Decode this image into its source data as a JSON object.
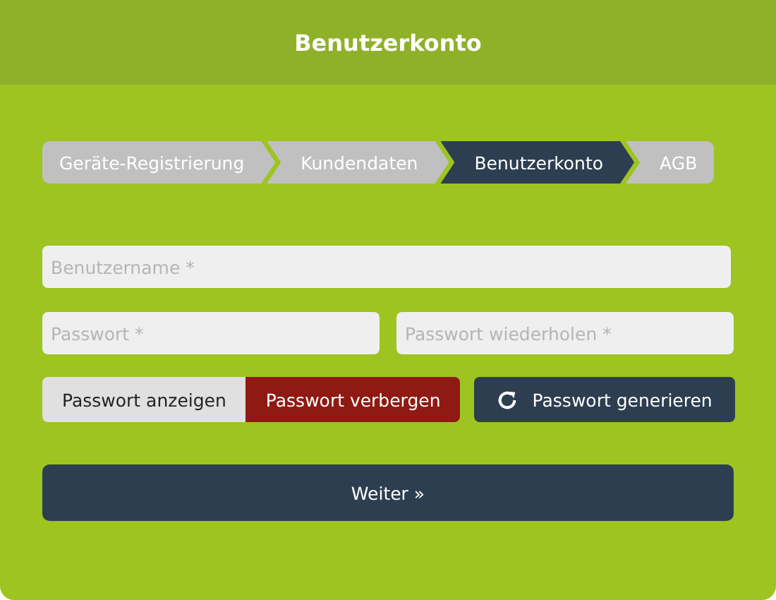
{
  "header": {
    "title": "Benutzerkonto"
  },
  "steps": [
    {
      "label": "Geräte-Registrierung",
      "selected": false
    },
    {
      "label": "Kundendaten",
      "selected": false
    },
    {
      "label": "Benutzerkonto",
      "selected": true
    },
    {
      "label": "AGB",
      "selected": false
    }
  ],
  "fields": {
    "username": {
      "placeholder": "Benutzername *"
    },
    "password": {
      "placeholder": "Passwort *"
    },
    "password_repeat": {
      "placeholder": "Passwort wiederholen *"
    }
  },
  "visibility_toggle": [
    {
      "label": "Passwort anzeigen",
      "selected": false
    },
    {
      "label": "Passwort verbergen",
      "selected": true
    }
  ],
  "generate_button": {
    "label": "Passwort generieren"
  },
  "next_button": {
    "label": "Weiter »"
  }
}
